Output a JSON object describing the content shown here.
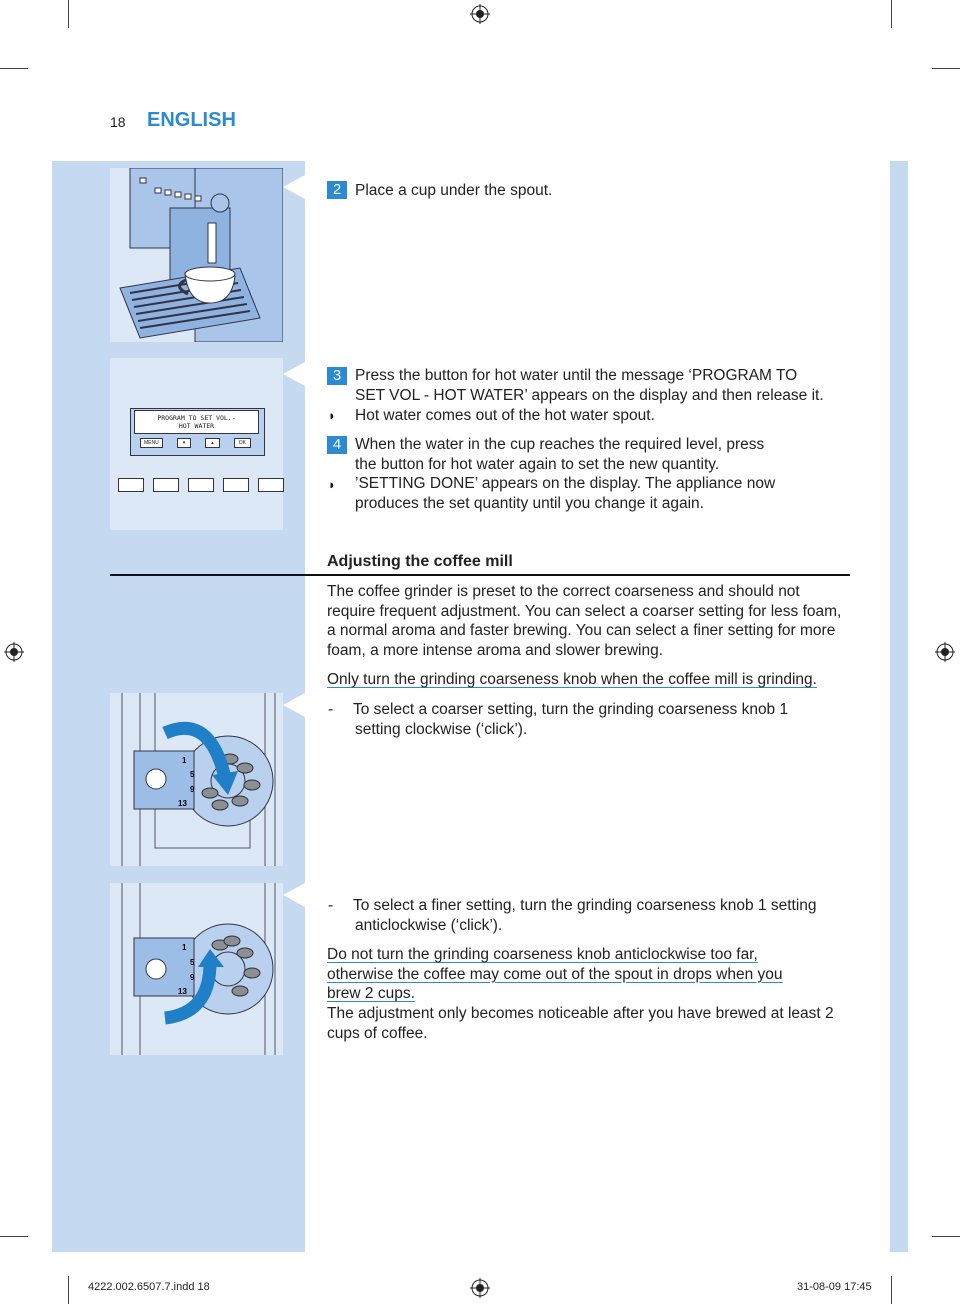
{
  "header": {
    "page_number": "18",
    "language": "ENGLISH"
  },
  "colors": {
    "accent": "#2a8ad4",
    "panel_blue": "#c5d9f1"
  },
  "steps": [
    {
      "number": "2",
      "text": "Place a cup under the spout."
    },
    {
      "number": "3",
      "lines": [
        "Press the button for hot water until the message ‘PROGRAM TO",
        "SET VOL - HOT WATER’ appears on the display and then release it."
      ]
    },
    {
      "bullet": "◗",
      "text": "Hot water comes out of the hot water spout."
    },
    {
      "number": "4",
      "lines": [
        "When the water in the cup reaches the required level, press",
        "the button for hot water again to set the new quantity."
      ]
    },
    {
      "bullet": "◗",
      "lines": [
        "’SETTING DONE’ appears on the display. The appliance now",
        "produces the set quantity until you change it again."
      ]
    }
  ],
  "display_illustration": {
    "screen_lines": [
      "PROGRAM TO SET VOL.-",
      "HOT WATER"
    ],
    "buttons": [
      "MENU",
      "▾",
      "▴",
      "OK"
    ]
  },
  "section": {
    "title": "Adjusting the coffee mill",
    "intro": [
      "The coffee grinder is preset to the correct coarseness and should not",
      "require frequent adjustment. You can select a coarser setting for less foam,",
      "a normal aroma and faster brewing. You can select a finer setting for more",
      "foam, a more intense aroma and slower brewing."
    ],
    "warning": "Only turn the grinding coarseness knob when the coffee mill is grinding.",
    "coarser": [
      "To select a coarser setting, turn the grinding coarseness knob 1",
      "setting clockwise (‘click’)."
    ],
    "finer": [
      "To select a finer setting, turn the grinding coarseness knob 1 setting",
      "anticlockwise (‘click’)."
    ],
    "caution": [
      "Do not turn the grinding coarseness knob anticlockwise too far,",
      "otherwise the coffee may come out of the spout in drops when you",
      "brew 2 cups."
    ],
    "note": [
      "The adjustment only becomes noticeable after you have brewed at least 2",
      "cups of coffee."
    ],
    "dash": "-",
    "dial_labels": [
      "1",
      "5",
      "9",
      "13"
    ]
  },
  "footer": {
    "file": "4222.002.6507.7.indd   18",
    "date": "31-08-09   17:45"
  }
}
